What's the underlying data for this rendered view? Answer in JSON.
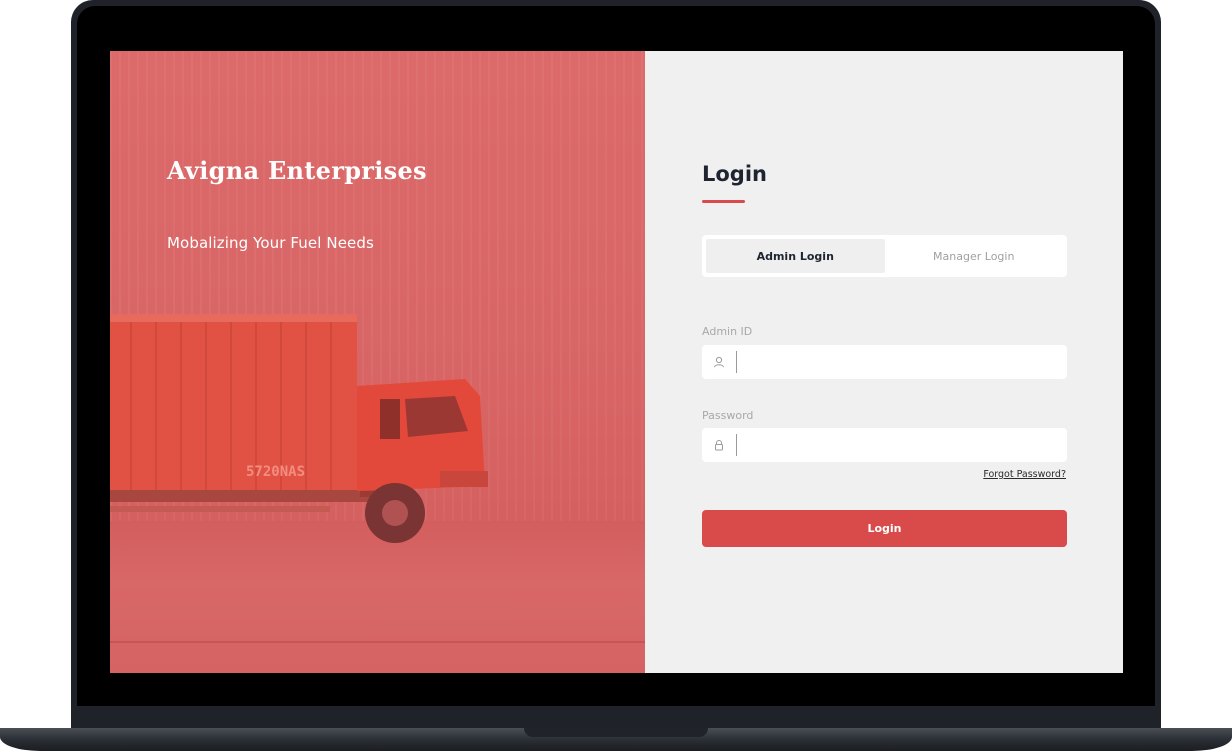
{
  "brand": {
    "name": "Avigna Enterprises",
    "tagline": "Mobalizing Your Fuel Needs"
  },
  "login": {
    "heading": "Login",
    "tabs": [
      {
        "label": "Admin Login",
        "active": true
      },
      {
        "label": "Manager Login",
        "active": false
      }
    ],
    "admin_id": {
      "label": "Admin ID",
      "value": "",
      "placeholder": "",
      "icon": "user-icon"
    },
    "password": {
      "label": "Password",
      "value": "",
      "placeholder": "",
      "icon": "lock-icon"
    },
    "forgot_label": "Forgot Password?",
    "submit_label": "Login"
  },
  "hero_image": {
    "truck_plate": "5720NAS"
  },
  "colors": {
    "accent": "#d94a4a",
    "hero_overlay": "#d86464",
    "panel_background": "#f0f0f0",
    "heading_text": "#1e2430"
  }
}
